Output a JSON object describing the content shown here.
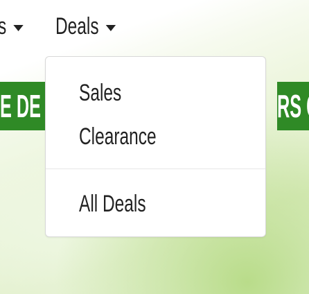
{
  "nav": {
    "prev_label": "s",
    "deals_label": "Deals"
  },
  "banner": {
    "left_text": "E DE",
    "right_text": "RS C"
  },
  "dropdown": {
    "items": [
      {
        "label": "Sales"
      },
      {
        "label": "Clearance"
      },
      {
        "label": "All Deals"
      }
    ]
  },
  "colors": {
    "banner_green": "#2f8a26",
    "text": "#222222",
    "dropdown_border": "#d8d8d8"
  }
}
